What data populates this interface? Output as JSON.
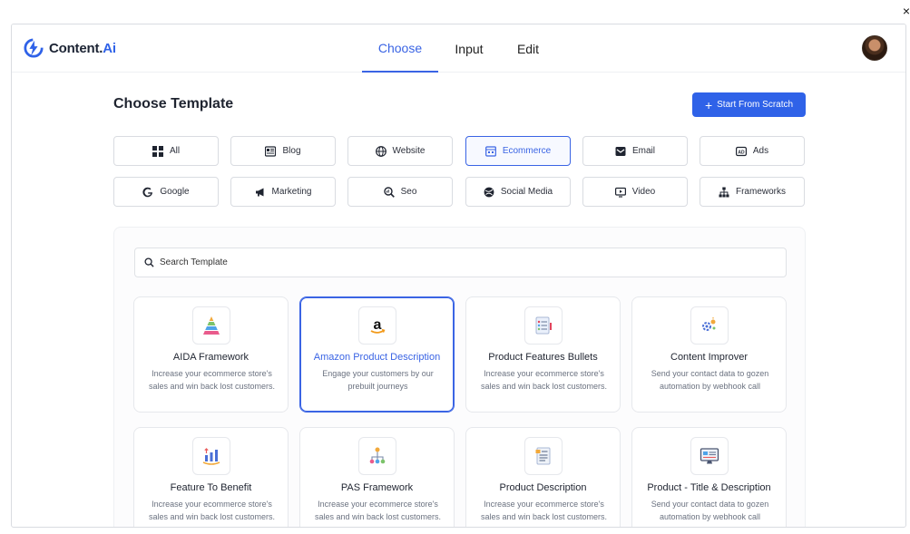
{
  "app": {
    "brand_main": "Content.",
    "brand_accent": "Ai",
    "corner_mark": "×"
  },
  "nav": {
    "tabs": [
      {
        "label": "Choose",
        "active": true
      },
      {
        "label": "Input",
        "active": false
      },
      {
        "label": "Edit",
        "active": false
      }
    ]
  },
  "page": {
    "title": "Choose Template",
    "scratch_button": "Start From Scratch"
  },
  "filters": [
    {
      "label": "All",
      "icon": "grid-icon",
      "active": false
    },
    {
      "label": "Blog",
      "icon": "blog-icon",
      "active": false
    },
    {
      "label": "Website",
      "icon": "globe-icon",
      "active": false
    },
    {
      "label": "Ecommerce",
      "icon": "store-icon",
      "active": true
    },
    {
      "label": "Email",
      "icon": "email-icon",
      "active": false
    },
    {
      "label": "Ads",
      "icon": "ads-icon",
      "active": false
    },
    {
      "label": "Google",
      "icon": "google-icon",
      "active": false
    },
    {
      "label": "Marketing",
      "icon": "megaphone-icon",
      "active": false
    },
    {
      "label": "Seo",
      "icon": "seo-icon",
      "active": false
    },
    {
      "label": "Social Media",
      "icon": "social-icon",
      "active": false
    },
    {
      "label": "Video",
      "icon": "video-icon",
      "active": false
    },
    {
      "label": "Frameworks",
      "icon": "frameworks-icon",
      "active": false
    }
  ],
  "search": {
    "placeholder": "Search Template"
  },
  "templates": [
    {
      "title": "AIDA Framework",
      "desc": "Increase your ecommerce store's sales and win back lost customers.",
      "icon": "pyramid-icon",
      "selected": false
    },
    {
      "title": "Amazon Product Description",
      "desc": "Engage your customers by our prebuilt journeys",
      "icon": "amazon-icon",
      "selected": true
    },
    {
      "title": "Product Features Bullets",
      "desc": "Increase your ecommerce store's sales and win back lost customers.",
      "icon": "checklist-icon",
      "selected": false
    },
    {
      "title": "Content Improver",
      "desc": "Send your contact data to gozen automation by webhook call",
      "icon": "improver-icon",
      "selected": false
    },
    {
      "title": "Feature To Benefit",
      "desc": "Increase your ecommerce store's sales and win back lost customers.",
      "icon": "growth-icon",
      "selected": false
    },
    {
      "title": "PAS Framework",
      "desc": "Increase your ecommerce store's sales and win back lost customers.",
      "icon": "hierarchy-icon",
      "selected": false
    },
    {
      "title": "Product Description",
      "desc": "Increase your ecommerce store's sales and win back lost customers.",
      "icon": "document-icon",
      "selected": false
    },
    {
      "title": "Product - Title & Description",
      "desc": "Send your contact data to gozen automation by webhook call",
      "icon": "monitor-icon",
      "selected": false
    }
  ],
  "colors": {
    "accent": "#2f62e8",
    "border": "#d9dce1",
    "muted_text": "#6b7280"
  }
}
